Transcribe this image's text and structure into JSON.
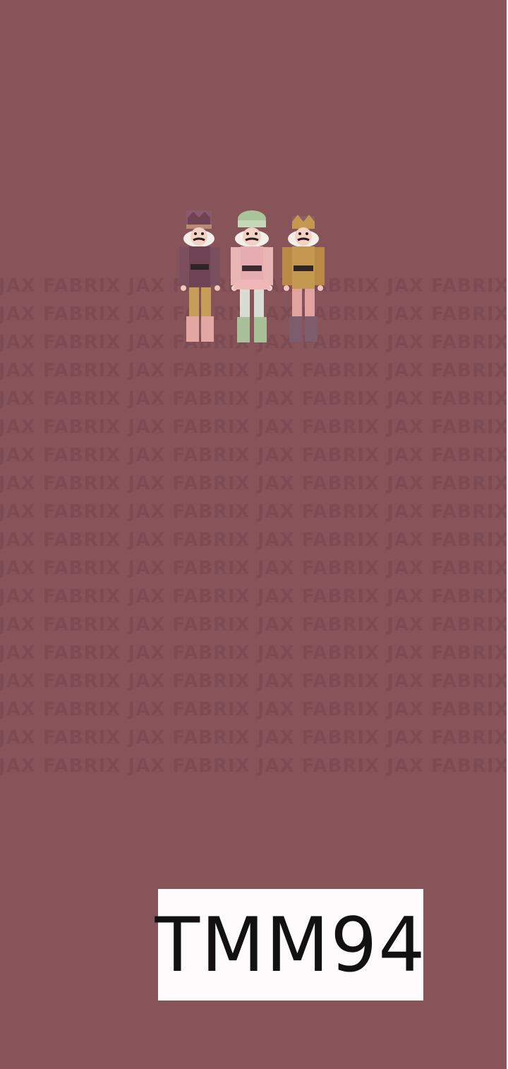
{
  "design": {
    "background_color": "#87545a",
    "watermark_color": "#7d4c52"
  },
  "watermark": {
    "text": "JAX FABRIX JAX FABRIX JAX FABRIX JAX FABRIX JAX FABRIX JAX FABRIX"
  },
  "illustration": {
    "subject": "three-nutcrackers",
    "figures": [
      {
        "name": "plum-nutcracker",
        "coat": "#6f4353",
        "hat": "#8a5a6c",
        "legs": "#c79d5a",
        "boots": "#e3a7a4"
      },
      {
        "name": "pink-nutcracker",
        "coat": "#e6adb0",
        "hat": "#a9c39b",
        "legs": "#d9dcd5",
        "boots": "#a8bf98"
      },
      {
        "name": "gold-nutcracker",
        "coat": "#c4984f",
        "hat": "#8a6068",
        "legs": "#e1a2a0",
        "boots": "#7d5d6c"
      }
    ]
  },
  "label": {
    "code": "TMM94",
    "background_color": "#fdfbfb",
    "text_color": "#111111"
  }
}
